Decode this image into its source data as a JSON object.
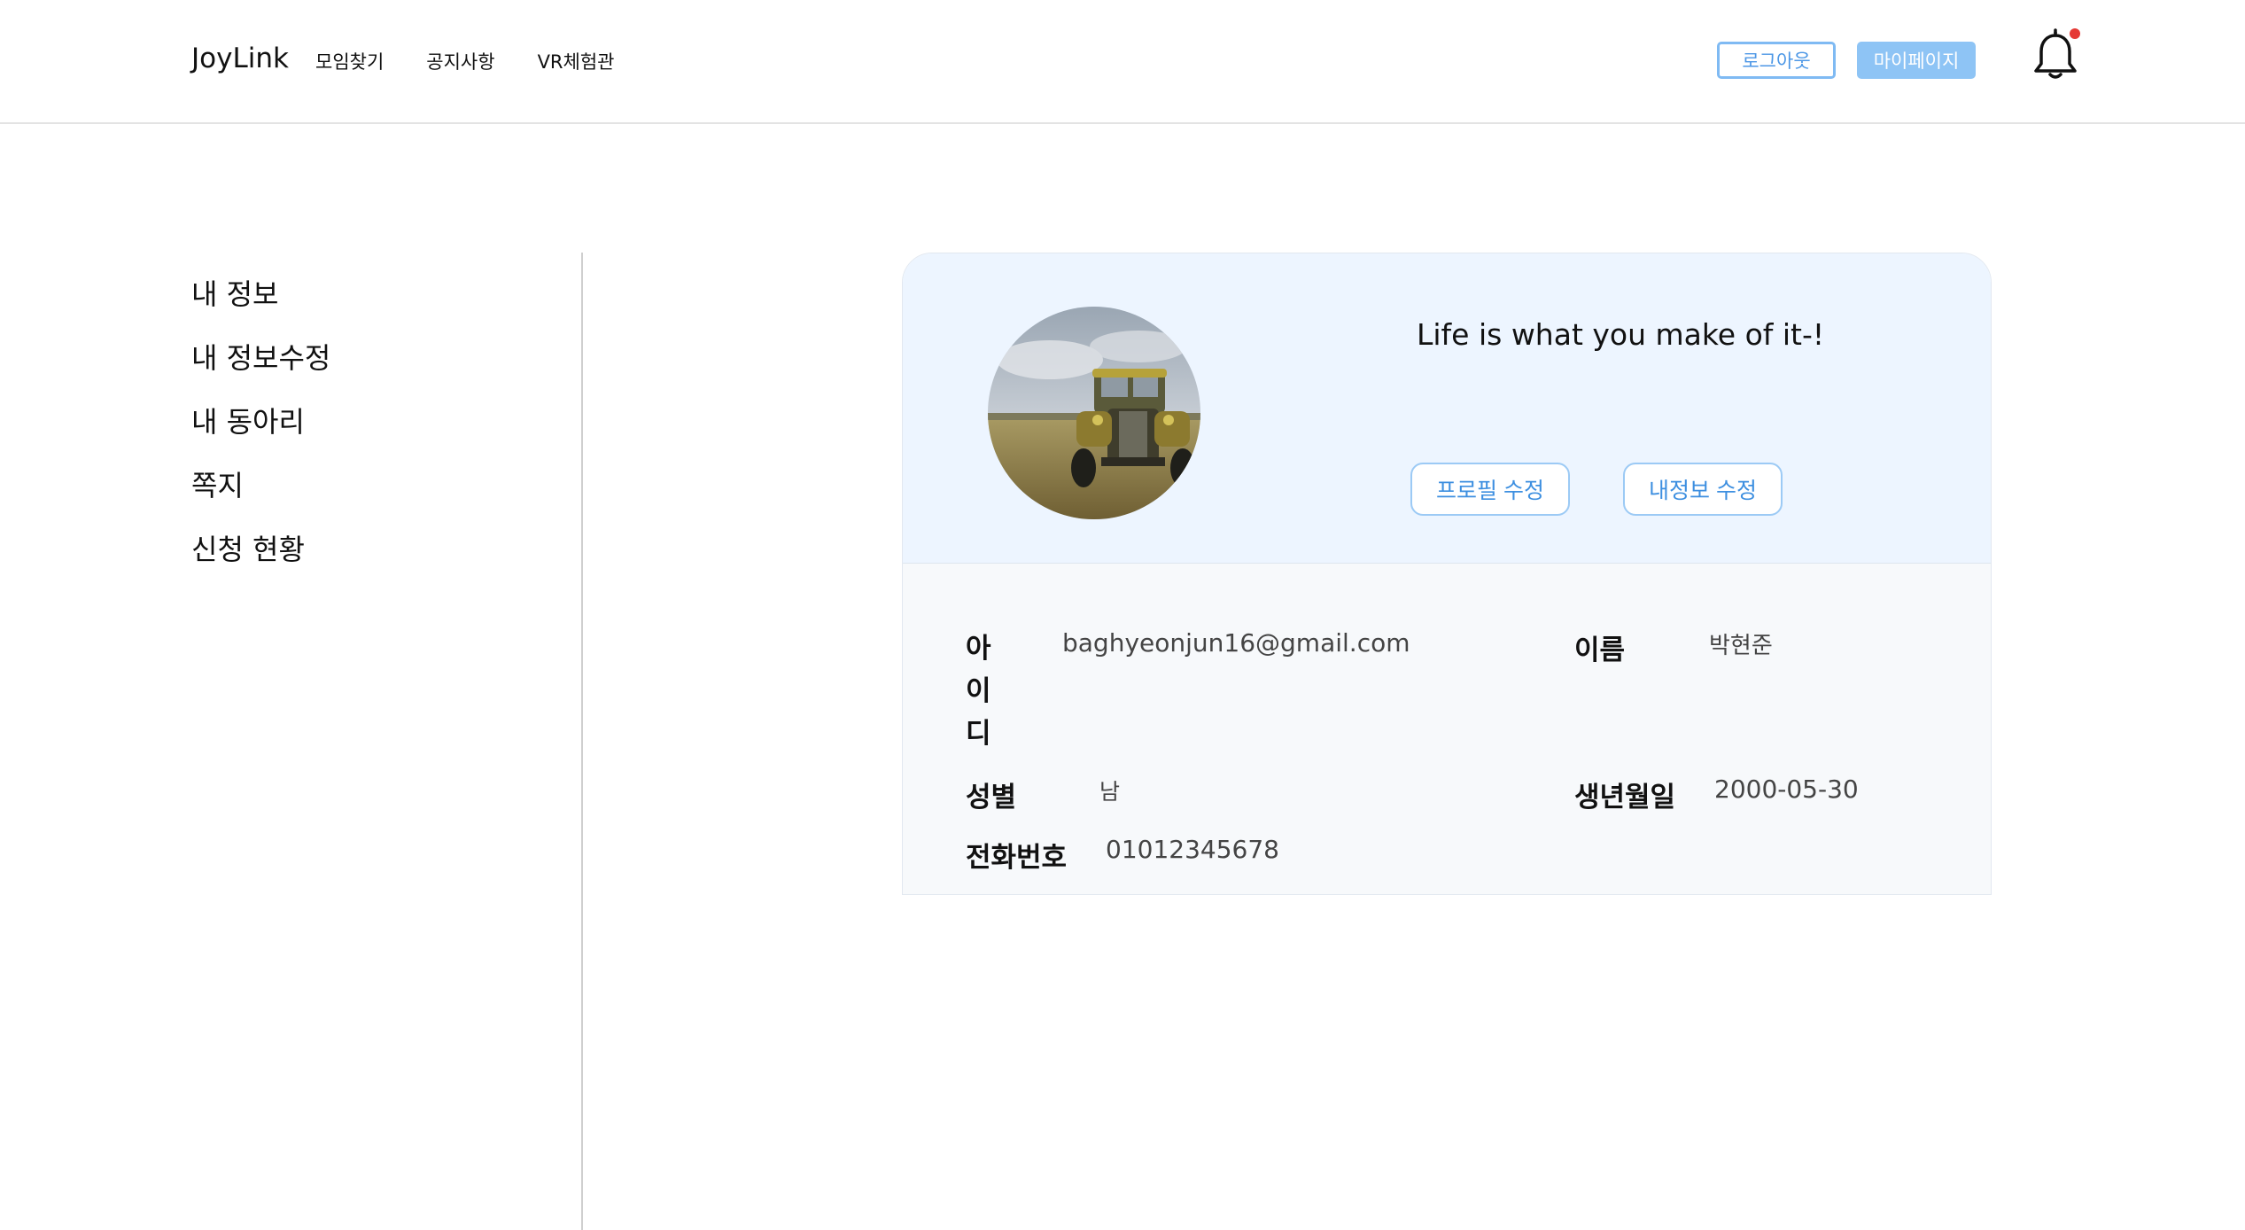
{
  "header": {
    "logo": "JoyLink",
    "nav": [
      "모임찾기",
      "공지사항",
      "VR체험관"
    ],
    "logout_label": "로그아웃",
    "mypage_label": "마이페이지",
    "notification_dot_color": "#e53935"
  },
  "sidebar": {
    "items": [
      {
        "label": "내 정보"
      },
      {
        "label": "내 정보수정"
      },
      {
        "label": "내 동아리"
      },
      {
        "label": "쪽지"
      },
      {
        "label": "신청 현황"
      }
    ]
  },
  "profile": {
    "motto": "Life is what you make of it-!",
    "edit_profile_label": "프로필 수정",
    "edit_info_label": "내정보 수정",
    "fields": {
      "id_label": "아이디",
      "id_value": "baghyeonjun16@gmail.com",
      "name_label": "이름",
      "name_value": "박현준",
      "gender_label": "성별",
      "gender_value": "남",
      "birth_label": "생년월일",
      "birth_value": "2000-05-30",
      "phone_label": "전화번호",
      "phone_value": "01012345678"
    }
  },
  "colors": {
    "accent": "#8ec4f5",
    "accent_text": "#3d8fe0",
    "card_top_bg": "#edf5ff",
    "card_bottom_bg": "#f7f9fb"
  }
}
